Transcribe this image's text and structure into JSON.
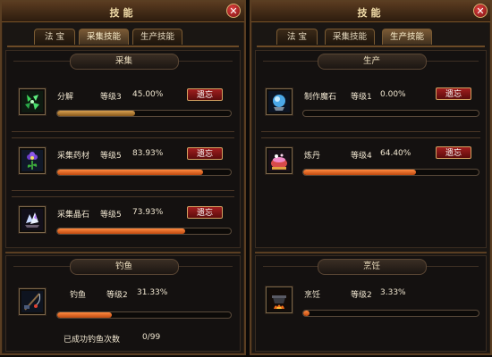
{
  "left": {
    "title": "技能",
    "tabs": [
      "法 宝",
      "采集技能",
      "生产技能"
    ],
    "sections": {
      "gather": {
        "title": "采集"
      },
      "fishing": {
        "title": "钓鱼"
      }
    },
    "skills": [
      {
        "name": "分解",
        "level_text": "等级3",
        "percent_text": "45.00%",
        "progress": 0.45,
        "button": "遗忘",
        "icon": "green-shards-icon"
      },
      {
        "name": "采集药材",
        "level_text": "等级5",
        "percent_text": "83.93%",
        "progress": 0.8393,
        "button": "遗忘",
        "icon": "herb-flower-icon"
      },
      {
        "name": "采集晶石",
        "level_text": "等级5",
        "percent_text": "73.93%",
        "progress": 0.7393,
        "button": "遗忘",
        "icon": "crystal-ore-icon"
      }
    ],
    "fishing": {
      "name": "钓鱼",
      "level_text": "等级2",
      "percent_text": "31.33%",
      "progress": 0.3133,
      "icon": "fishing-rod-icon",
      "count_label": "已成功钓鱼次数",
      "count_value": "0/99"
    }
  },
  "right": {
    "title": "技能",
    "tabs": [
      "法 宝",
      "采集技能",
      "生产技能"
    ],
    "sections": {
      "production": {
        "title": "生产"
      },
      "cooking": {
        "title": "烹饪"
      }
    },
    "skills": [
      {
        "name": "制作魔石",
        "level_text": "等级1",
        "percent_text": "0.00%",
        "progress": 0.0,
        "button": "遗忘",
        "icon": "magic-stone-icon"
      },
      {
        "name": "炼丹",
        "level_text": "等级4",
        "percent_text": "64.40%",
        "progress": 0.644,
        "button": "遗忘",
        "icon": "alchemy-cauldron-icon"
      }
    ],
    "cooking": {
      "name": "烹饪",
      "level_text": "等级2",
      "percent_text": "3.33%",
      "progress": 0.0333,
      "icon": "cooking-pot-icon"
    }
  },
  "colors": {
    "bar_brown": "#c8903c",
    "bar_orange": "#e8682a",
    "button_red": "#8a1616",
    "frame_brown": "#5a3e22"
  }
}
